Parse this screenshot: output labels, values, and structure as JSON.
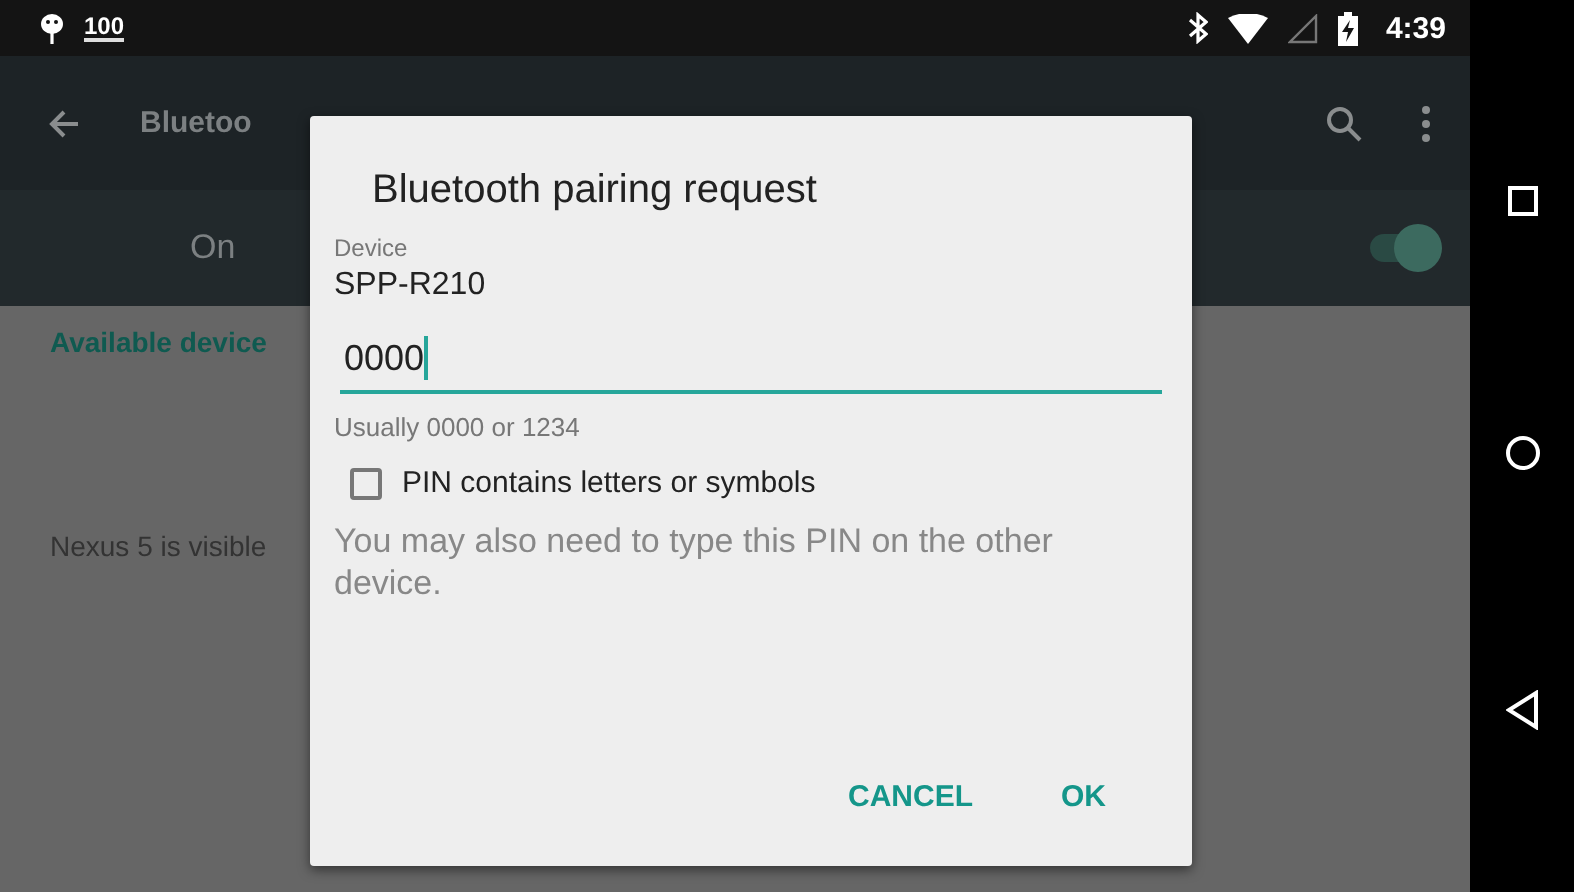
{
  "status_bar": {
    "notification_count": "100",
    "time": "4:39"
  },
  "toolbar": {
    "title": "Bluetoo"
  },
  "bluetooth_switch": {
    "label": "On",
    "on": true
  },
  "content": {
    "section_header": "Available device",
    "visibility_text": "Nexus 5 is visible"
  },
  "dialog": {
    "title": "Bluetooth pairing request",
    "device_label": "Device",
    "device_name": "SPP-R210",
    "pin_value": "0000",
    "hint": "Usually 0000 or 1234",
    "checkbox": {
      "label": "PIN contains letters or symbols",
      "checked": false
    },
    "message": "You may also need to type this PIN on the other device.",
    "buttons": [
      {
        "label": "CANCEL"
      },
      {
        "label": "OK"
      }
    ]
  }
}
